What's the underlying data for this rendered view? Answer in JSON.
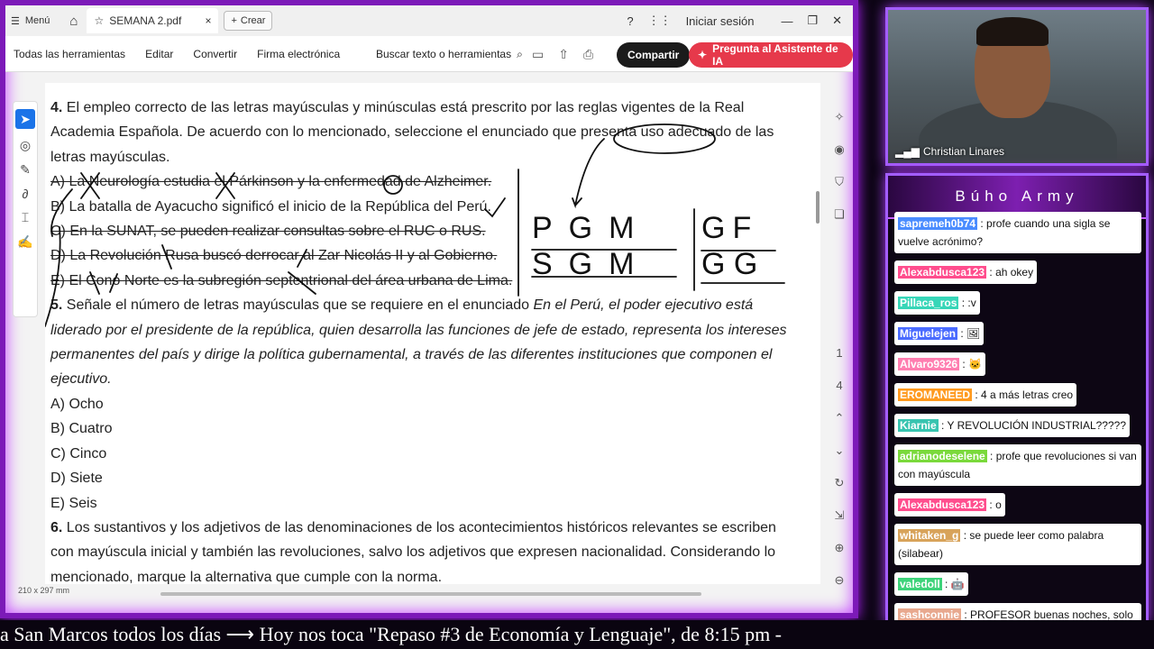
{
  "app": {
    "menu_label": "Menú",
    "tab_title": "SEMANA 2.pdf",
    "create_label": "Crear",
    "signin_label": "Iniciar sesión"
  },
  "toolbar": {
    "all_tools": "Todas las herramientas",
    "edit": "Editar",
    "convert": "Convertir",
    "esign": "Firma electrónica",
    "search": "Buscar texto o herramientas",
    "share": "Compartir",
    "ai": "Pregunta al Asistente de IA"
  },
  "doc": {
    "q4_num": "4.",
    "q4_line1": "El empleo correcto de las letras mayúsculas y minúsculas está prescrito por las reglas vigentes de la Real",
    "q4_line2": "Academia Española. De acuerdo con lo mencionado, seleccione el enunciado que presenta uso adecuado de las",
    "q4_line3": "letras mayúsculas.",
    "q4_a": "A) La Neurología estudia el Párkinson y la enfermedad de Alzheimer.",
    "q4_b": "B) La batalla de Ayacucho significó el inicio de la República del Perú.",
    "q4_c": "C) En la SUNAT, se pueden realizar consultas sobre el RUC o RUS.",
    "q4_d": "D) La Revolución Rusa buscó derrocar al Zar Nicolás II y al Gobierno.",
    "q4_e": "E) El Cono Norte es la subregión septentrional del área urbana de Lima.",
    "q5_num": "5.",
    "q5_line1": "Señale el número de letras mayúsculas que se requiere en el enunciado",
    "q5_quote1": "En el Perú, el poder ejecutivo está",
    "q5_line2": "liderado por el presidente de la república, quien desarrolla las funciones de jefe de estado, representa los intereses",
    "q5_line3": "permanentes del país y dirige la política gubernamental, a través de las diferentes instituciones que componen el",
    "q5_line4": "ejecutivo.",
    "q5_a": "A) Ocho",
    "q5_b": "B) Cuatro",
    "q5_c": "C) Cinco",
    "q5_d": "D) Siete",
    "q5_e": "E) Seis",
    "q6_num": "6.",
    "q6_line1": "Los sustantivos y los adjetivos de las denominaciones de los acontecimientos históricos relevantes se escriben",
    "q6_line2": "con mayúscula inicial y también las revoluciones, salvo los adjetivos que expresen nacionalidad. Considerando lo",
    "q6_line3": "mencionado, marque la alternativa que cumple con la norma.",
    "page_size": "210 x 297 mm",
    "page_current": "1",
    "page_total": "4",
    "ink_pgm": "PGM",
    "ink_sgm": "SGM",
    "ink_gf": "GF",
    "ink_gg": "G G"
  },
  "camera": {
    "name": "Christian Linares"
  },
  "chat": {
    "title": "Búho Army",
    "messages": [
      {
        "user": "sapremeh0b74",
        "color": "#4a8cff",
        "text": ": profe cuando una sigla se vuelve acrónimo?"
      },
      {
        "user": "Alexabdusca123",
        "color": "#ff4d8d",
        "text": ": ah okey"
      },
      {
        "user": "Pillaca_ros",
        "color": "#37d6b8",
        "text": ": :v"
      },
      {
        "user": "Miguelejen",
        "color": "#4a6bff",
        "text": ": 🖼"
      },
      {
        "user": "Alvaro9326",
        "color": "#ff7eb0",
        "text": ": 🐱"
      },
      {
        "user": "EROMANEED",
        "color": "#ff9a1f",
        "text": ": 4 a más letras creo"
      },
      {
        "user": "Kiarnie",
        "color": "#38c4b0",
        "text": ": Y REVOLUCIÓN INDUSTRIAL?????"
      },
      {
        "user": "adrianodeselene",
        "color": "#7ad93b",
        "text": ": profe que revoluciones si van con mayúscula"
      },
      {
        "user": "Alexabdusca123",
        "color": "#ff4d8d",
        "text": ": o"
      },
      {
        "user": "whitaken_g",
        "color": "#d8a35a",
        "text": ": se puede leer como palabra (silabear)"
      },
      {
        "user": "valedoll",
        "color": "#3ed37a",
        "text": ": 🤖"
      },
      {
        "user": "sashconnie",
        "color": "#e8a88e",
        "text": ": PROFESOR buenas noches, solo alzhéimer lleva mayúscula cuando hay un de???"
      }
    ]
  },
  "ticker": "a San Marcos todos los días  ⟶  Hoy nos toca \"Repaso #3 de Economía y Lenguaje\", de 8:15 pm -"
}
